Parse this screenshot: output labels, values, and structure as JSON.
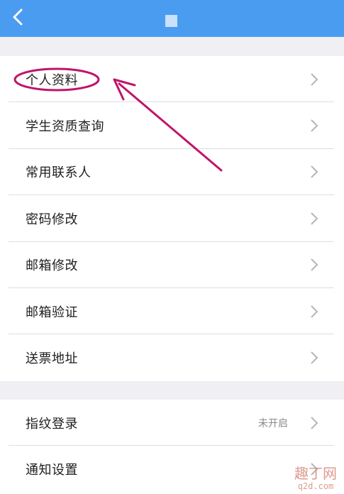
{
  "colors": {
    "header": "#4a9cf0",
    "annotation": "#c0156b",
    "chevron": "#b6b6b6"
  },
  "header": {
    "back_icon": "chevron-left-icon",
    "title": ""
  },
  "menu_group_1": [
    {
      "label": "个人资料"
    },
    {
      "label": "学生资质查询"
    },
    {
      "label": "常用联系人"
    },
    {
      "label": "密码修改"
    },
    {
      "label": "邮箱修改"
    },
    {
      "label": "邮箱验证"
    },
    {
      "label": "送票地址"
    }
  ],
  "menu_group_2": [
    {
      "label": "指纹登录",
      "status": "未开启"
    },
    {
      "label": "通知设置"
    }
  ],
  "watermark": {
    "line1": "趣丁网",
    "line2": "q2d.com"
  }
}
